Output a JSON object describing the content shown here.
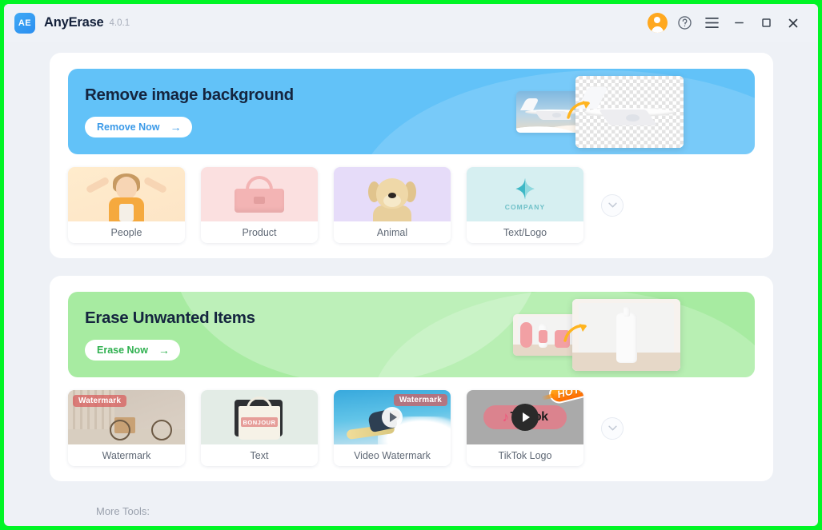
{
  "window": {
    "app_name": "AnyErase",
    "version": "4.0.1",
    "logo_text": "AE",
    "controls": {
      "account": "account-avatar",
      "help": "?",
      "menu": "☰",
      "minimize": "—",
      "maximize": "☐",
      "close": "✕"
    },
    "accent_blue": "#3b9ae8",
    "accent_green": "#2fb04f",
    "highlight_border": "#00f525"
  },
  "sections": [
    {
      "id": "remove-background",
      "banner": {
        "title": "Remove image background",
        "cta_label": "Remove Now",
        "cta_arrow": "→",
        "color": "#62c2f8",
        "artwork": "airplane-before-after"
      },
      "cards": [
        {
          "label": "People",
          "thumb": "girl-photo",
          "bg": "#ffeccd"
        },
        {
          "label": "Product",
          "thumb": "pink-handbag",
          "bg": "#fbe0e0"
        },
        {
          "label": "Animal",
          "thumb": "golden-retriever",
          "bg": "#e6dcf9"
        },
        {
          "label": "Text/Logo",
          "thumb": "company-logo",
          "bg": "#d6eff1",
          "logo_word": "COMPANY"
        }
      ],
      "expand_icon": "chevron-down"
    },
    {
      "id": "erase-items",
      "banner": {
        "title": "Erase Unwanted Items",
        "cta_label": "Erase Now",
        "cta_arrow": "→",
        "color": "#a7eba1",
        "artwork": "bottle-before-after"
      },
      "cards": [
        {
          "label": "Watermark",
          "thumb": "bicycle-photo",
          "overlay_text": "Watermark"
        },
        {
          "label": "Text",
          "thumb": "tote-bag",
          "overlay_text": "BONJOUR"
        },
        {
          "label": "Video Watermark",
          "thumb": "surfer-video",
          "overlay_text": "Watermark",
          "has_play": true
        },
        {
          "label": "TikTok Logo",
          "thumb": "tiktok-video",
          "overlay_text": "TikTok",
          "has_play": true,
          "badge": "HOT!"
        }
      ],
      "expand_icon": "chevron-down"
    }
  ],
  "footer": {
    "more_tools_label": "More Tools:"
  }
}
